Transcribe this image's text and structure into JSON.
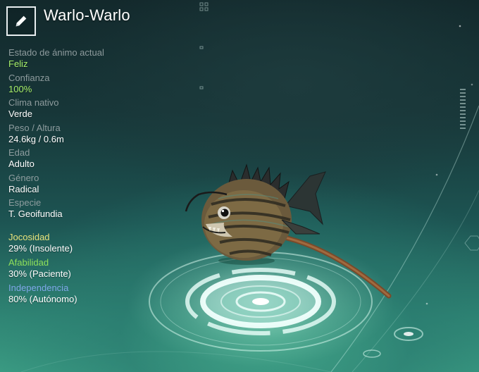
{
  "creature": {
    "name": "Warlo-Warlo"
  },
  "icons": {
    "edit": "pencil-icon"
  },
  "stats": [
    {
      "label": "Estado de ánimo actual",
      "value": "Feliz",
      "highlight": true
    },
    {
      "label": "Confianza",
      "value": "100%",
      "highlight": true
    },
    {
      "label": "Clima nativo",
      "value": "Verde",
      "highlight": false
    },
    {
      "label": "Peso / Altura",
      "value": "24.6kg / 0.6m",
      "highlight": false
    },
    {
      "label": "Edad",
      "value": "Adulto",
      "highlight": false
    },
    {
      "label": "Género",
      "value": "Radical",
      "highlight": false
    },
    {
      "label": "Especie",
      "value": "T. Geoifundia",
      "highlight": false
    }
  ],
  "traits": [
    {
      "label": "Jocosidad",
      "value": "29% (Insolente)",
      "color": "#e8e27a"
    },
    {
      "label": "Afabilidad",
      "value": "30% (Paciente)",
      "color": "#8fe05a"
    },
    {
      "label": "Independencia",
      "value": "80% (Autónomo)",
      "color": "#7fa6e8"
    }
  ],
  "colors": {
    "accent_green": "#a8f06a",
    "label_grey": "#9aa6a8",
    "hologram": "#d9f5ee"
  }
}
